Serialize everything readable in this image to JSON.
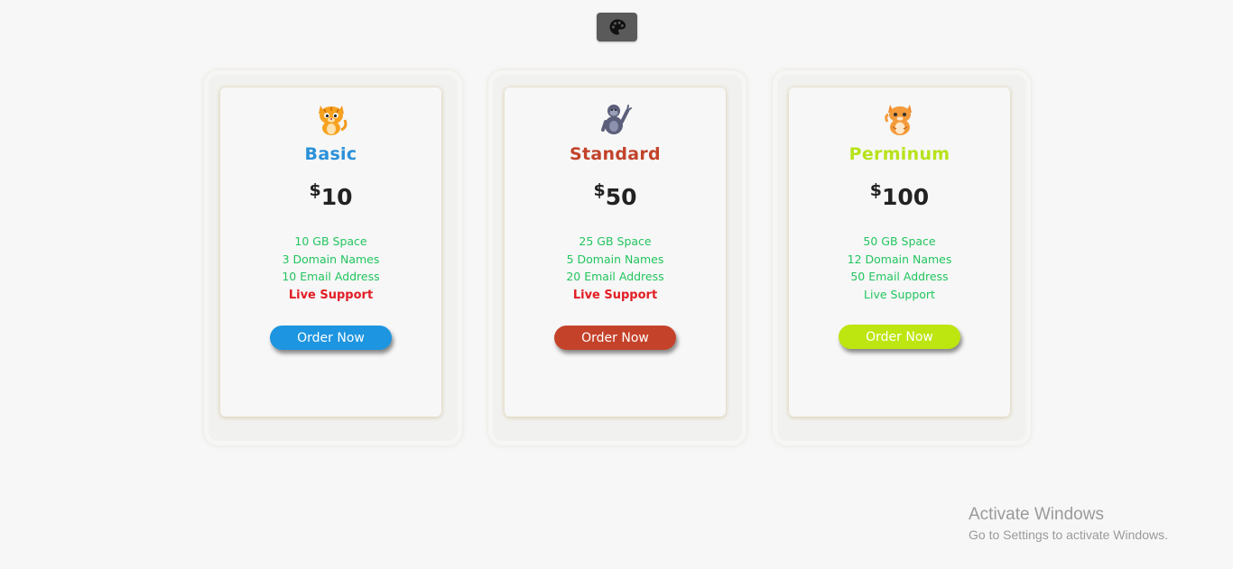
{
  "theme_toggle": {
    "icon": "palette-icon"
  },
  "plans": [
    {
      "icon": "orange-tiger-cat-icon",
      "name": "Basic",
      "name_color": "#2b90d9",
      "currency": "$",
      "price": "10",
      "features": [
        "10 GB Space",
        "3 Domain Names",
        "10 Email Address",
        "Live Support"
      ],
      "button_label": "Order Now",
      "button_color": "#1d95e0"
    },
    {
      "icon": "gorilla-icon",
      "name": "Standard",
      "name_color": "#c2432a",
      "currency": "$",
      "price": "50",
      "features": [
        "25 GB Space",
        "5 Domain Names",
        "20 Email Address",
        "Live Support"
      ],
      "button_label": "Order Now",
      "button_color": "#c5422a"
    },
    {
      "icon": "orange-cat-icon",
      "name": "Perminum",
      "name_color": "#b7e31a",
      "currency": "$",
      "price": "100",
      "features": [
        "50 GB Space",
        "12 Domain Names",
        "50 Email Address",
        "Live Support"
      ],
      "button_label": "Order Now",
      "button_color": "#bde50f"
    }
  ],
  "watermark": {
    "line1": "Activate Windows",
    "line2": "Go to Settings to activate Windows."
  }
}
